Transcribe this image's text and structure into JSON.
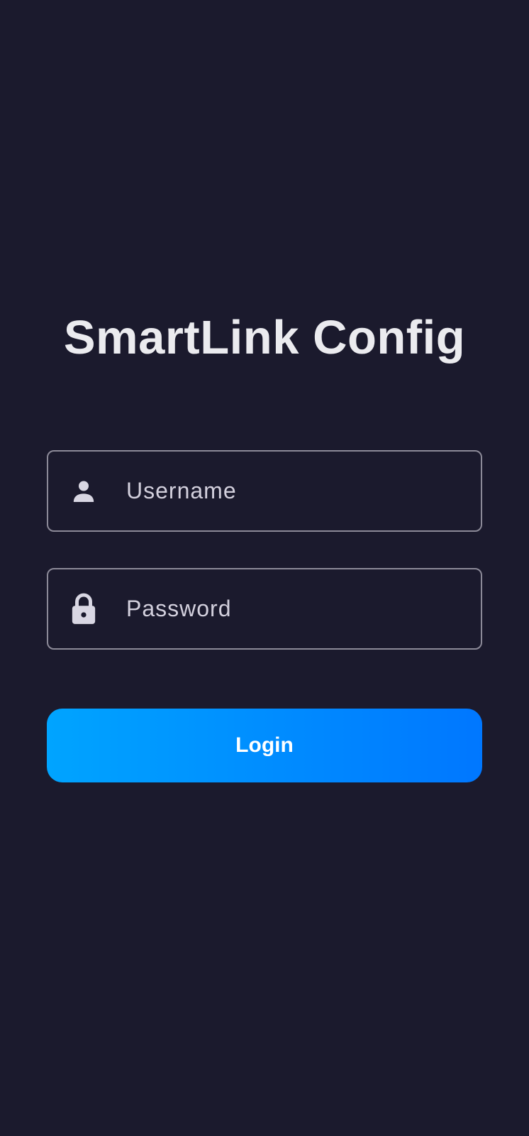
{
  "app": {
    "title": "SmartLink Config"
  },
  "form": {
    "username": {
      "placeholder": "Username",
      "value": "",
      "icon": "person-icon"
    },
    "password": {
      "placeholder": "Password",
      "value": "",
      "icon": "lock-icon"
    },
    "login_label": "Login"
  },
  "colors": {
    "background": "#1b1a2d",
    "title": "#ebebef",
    "field_border": "#8c8a98",
    "icon": "#d9d7e3",
    "button_gradient_start": "#00a4ff",
    "button_gradient_end": "#0077ff",
    "button_text": "#ffffff"
  }
}
